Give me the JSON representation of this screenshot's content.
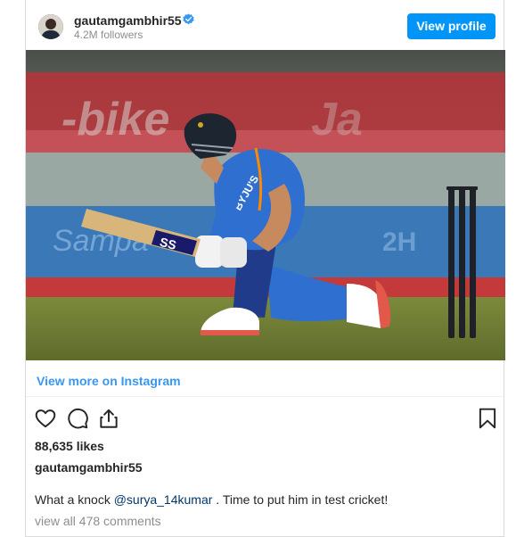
{
  "header": {
    "username": "gautamgambhir55",
    "followers": "4.2M followers",
    "view_profile_label": "View profile",
    "verified_icon": "verified-badge-icon"
  },
  "post": {
    "view_more_label": "View more on Instagram",
    "likes": "88,635 likes",
    "caption_username": "gautamgambhir55",
    "caption_prefix": "What a knock ",
    "caption_mention": "@surya_14kumar",
    "caption_suffix": " . Time to put him in test cricket!",
    "comments_link": "view all 478 comments"
  },
  "photo_text": {
    "bat_sticker": "SS",
    "jersey_sponsor": "BYJU'S"
  },
  "colors": {
    "accent": "#0095f6",
    "link": "#3897f0",
    "mention": "#00376b",
    "jersey": "#2f6fd0"
  },
  "icons": [
    "heart-icon",
    "comment-icon",
    "share-icon",
    "bookmark-icon"
  ]
}
